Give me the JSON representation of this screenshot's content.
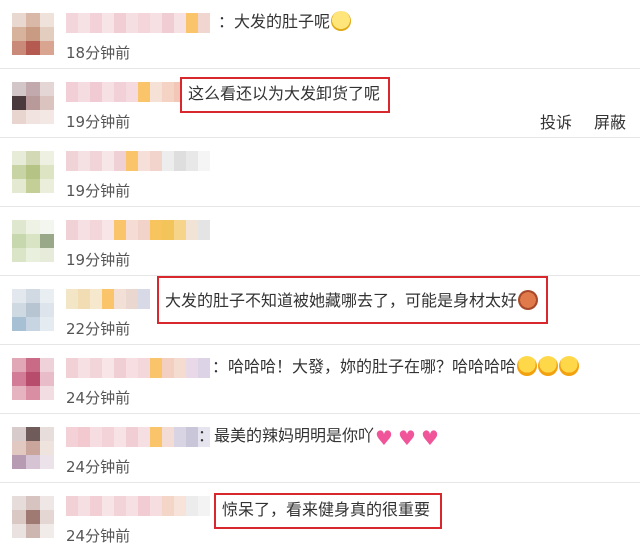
{
  "comments": [
    {
      "time": "18分钟前",
      "sep": "：",
      "text": "大发的肚子呢",
      "emoji": "shock",
      "boxed": false
    },
    {
      "time": "19分钟前",
      "sep": "",
      "text": "这么看还以为大发卸货了呢",
      "boxed": true,
      "actions": {
        "report": "投诉",
        "block": "屏蔽"
      }
    },
    {
      "time": "19分钟前",
      "sep": "",
      "text": "",
      "boxed": false
    },
    {
      "time": "19分钟前",
      "sep": "",
      "text": "",
      "boxed": false
    },
    {
      "time": "22分钟前",
      "sep": "",
      "text": "大发的肚子不知道被她藏哪去了，可能是身材太好",
      "emoji": "bear",
      "boxed": true
    },
    {
      "time": "24分钟前",
      "sep": "：",
      "text": "哈哈哈！大發，妳的肚子在哪？哈哈哈哈",
      "emoji": "laugh-x3",
      "boxed": false
    },
    {
      "time": "24分钟前",
      "sep": "：",
      "text": "最美的辣妈明明是你吖",
      "emoji": "heart-x3",
      "boxed": false
    },
    {
      "time": "24分钟前",
      "sep": "：",
      "text": "惊呆了，看来健身真的很重要",
      "boxed": true
    }
  ],
  "colors": {
    "highlight": "#d9272e",
    "divider": "#e6e6e6"
  }
}
